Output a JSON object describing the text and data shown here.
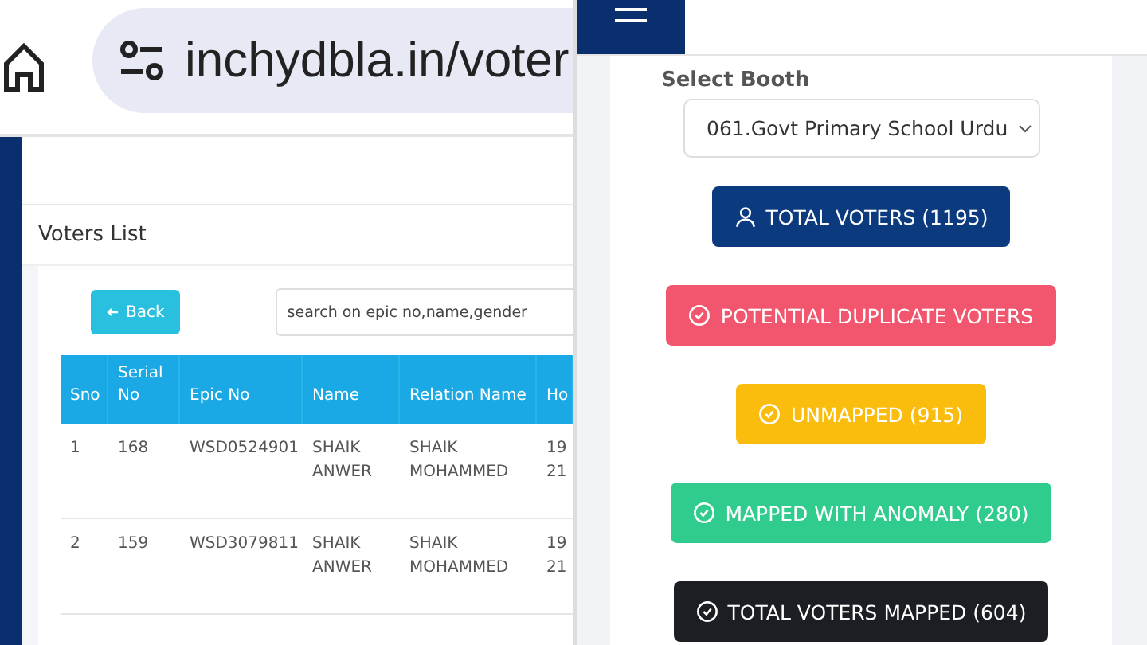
{
  "address_bar": {
    "url": "inchydbla.in/voter"
  },
  "voters_list": {
    "title": "Voters List",
    "back_button": "Back",
    "search": {
      "placeholder": "search on epic no,name,gender"
    },
    "table": {
      "columns": [
        "Sno",
        "Serial No",
        "Epic No",
        "Name",
        "Relation Name",
        "Ho"
      ],
      "rows": [
        [
          "1",
          "168",
          "WSD0524901",
          "SHAIK ANWER",
          "SHAIK MOHAMMED",
          "19\n21"
        ],
        [
          "2",
          "159",
          "WSD3079811",
          "SHAIK ANWER",
          "SHAIK MOHAMMED",
          "19\n21"
        ]
      ]
    }
  },
  "booth_panel": {
    "label": "Select Booth",
    "booth": "061.Govt Primary School Urdu",
    "buttons": [
      {
        "label": "TOTAL VOTERS (1195)",
        "kind": "user",
        "color": "#0b3b7e"
      },
      {
        "label": "POTENTIAL DUPLICATE VOTERS",
        "kind": "check",
        "color": "#f2566e"
      },
      {
        "label": "UNMAPPED (915)",
        "kind": "check",
        "color": "#fbbd0d"
      },
      {
        "label": "MAPPED WITH ANOMALY (280)",
        "kind": "check",
        "color": "#2fcc8e"
      },
      {
        "label": "TOTAL VOTERS MAPPED (604)",
        "kind": "check",
        "color": "#1c1e24"
      }
    ]
  }
}
